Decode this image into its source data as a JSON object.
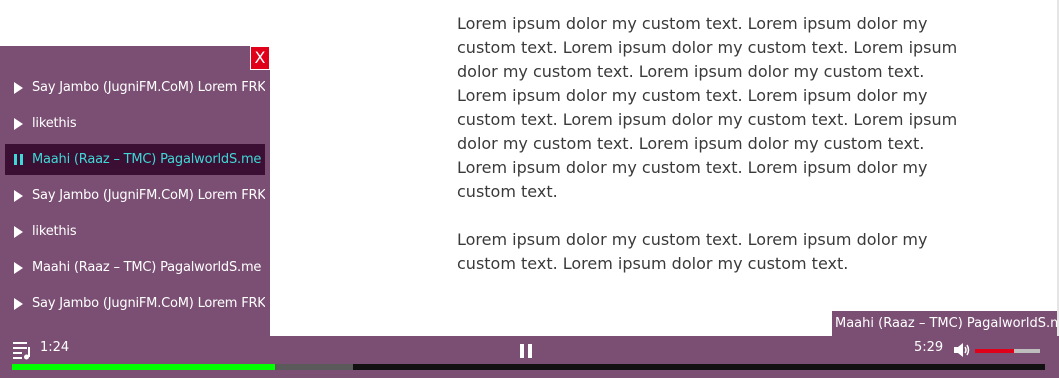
{
  "article": {
    "paragraphs": [
      "Lorem ipsum dolor my custom text. Lorem ipsum dolor my custom text. Lorem ipsum dolor my custom text. Lorem ipsum dolor my custom text. Lorem ipsum dolor my custom text. Lorem ipsum dolor my custom text. Lorem ipsum dolor my custom text. Lorem ipsum dolor my custom text. Lorem ipsum dolor my custom text. Lorem ipsum dolor my custom text. Lorem ipsum dolor my custom text. Lorem ipsum dolor my custom text.",
      "Lorem ipsum dolor my custom text. Lorem ipsum dolor my custom text. Lorem ipsum dolor my custom text."
    ]
  },
  "playlist": {
    "close_label": "X",
    "items": [
      {
        "label": "Say Jambo (JugniFM.CoM) Lorem FRK",
        "state": "play-icon"
      },
      {
        "label": "likethis",
        "state": "play-icon"
      },
      {
        "label": "Maahi (Raaz – TMC) PagalworldS.me",
        "state": "pause-icon",
        "active": true
      },
      {
        "label": "Say Jambo (JugniFM.CoM) Lorem FRK",
        "state": "play-icon"
      },
      {
        "label": "likethis",
        "state": "play-icon"
      },
      {
        "label": "Maahi (Raaz – TMC) PagalworldS.me",
        "state": "play-icon"
      },
      {
        "label": "Say Jambo (JugniFM.CoM) Lorem FRK",
        "state": "play-icon"
      }
    ]
  },
  "player": {
    "now_playing": "Maahi (Raaz – TMC) PagalworldS.me",
    "current_time": "1:24",
    "total_time": "5:29",
    "progress_fraction": 0.255,
    "buffered_fraction": 0.33,
    "volume_fraction": 0.6,
    "icons": [
      "playlist-icon",
      "pause-icon",
      "volume-icon"
    ]
  },
  "colors": {
    "panel": "#7b4f73",
    "active_row": "#3b0f33",
    "active_text": "#40d7d7",
    "close": "#e0001a",
    "progress": "#00ff00",
    "volume": "#e0001a"
  }
}
